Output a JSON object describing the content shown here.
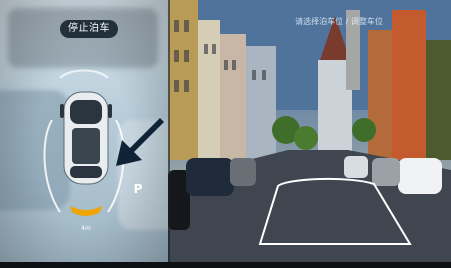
{
  "app": {
    "stop_parking_label": "停止泊车",
    "top_hint": "请选择泊车位 / 调整车位",
    "parking_spot_marker": "P",
    "distance_marker": "4m"
  },
  "colors": {
    "accent_orange": "#f0a400",
    "button_bg": "#21303b",
    "guide_line": "#ffffff"
  },
  "icons": {
    "direction_arrow": "arrow-down-left-icon",
    "parking": "parking-icon"
  }
}
